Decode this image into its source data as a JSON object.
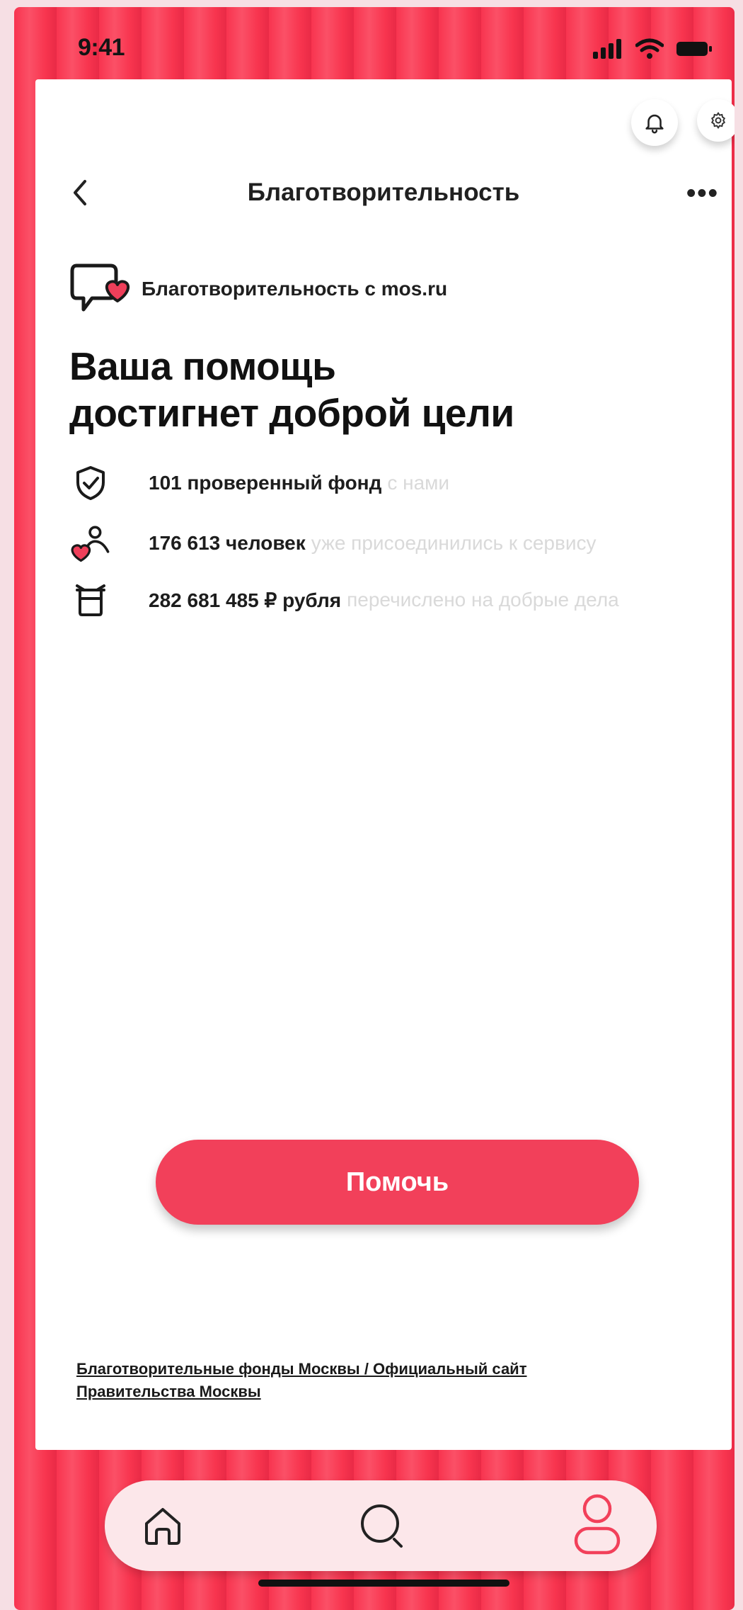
{
  "status_bar": {
    "time": "9:41"
  },
  "header": {
    "title": "Благотворительность"
  },
  "brand": {
    "label": "Благотворительность с mos.ru"
  },
  "headline": {
    "line1": "Ваша помощь",
    "line2": "достигнет доброй цели"
  },
  "stats": [
    {
      "icon": "shield-check-icon",
      "bold": "101 проверенный фонд",
      "light": "с нами"
    },
    {
      "icon": "person-heart-icon",
      "bold": "176 613 человек",
      "light": "уже присоединились к сервису"
    },
    {
      "icon": "gift-box-icon",
      "bold": "282 681 485 ₽ рубля",
      "light": "перечислено на добрые дела"
    }
  ],
  "actions": {
    "help_label": "Помочь"
  },
  "footer": {
    "link": "Благотворительные фонды Москвы / Официальный сайт Правительства Москвы"
  },
  "colors": {
    "accent": "#f2405a",
    "background": "#f8344f"
  }
}
